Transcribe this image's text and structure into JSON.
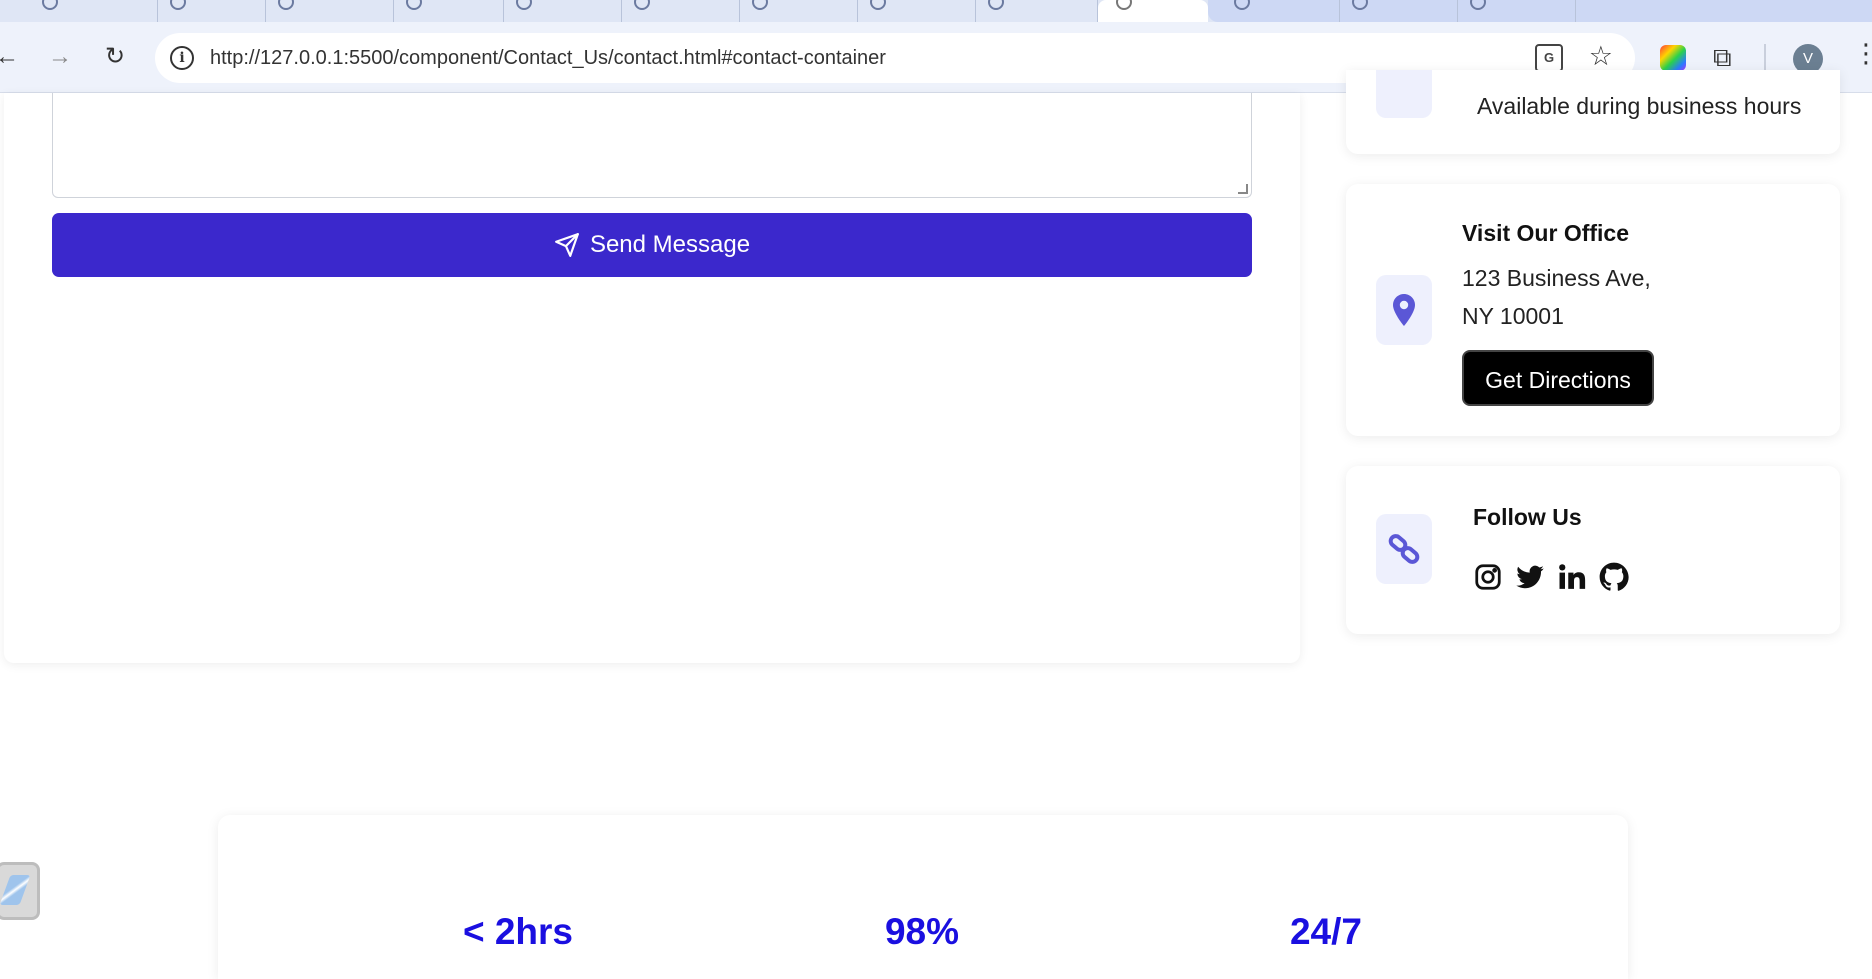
{
  "browser": {
    "url": "http://127.0.0.1:5500/component/Contact_Us/contact.html#contact-container",
    "profile_initial": "V"
  },
  "form": {
    "send_button_label": "Send Message"
  },
  "contact_cards": {
    "hours": {
      "text": "Available during business hours"
    },
    "office": {
      "title": "Visit Our Office",
      "address_line1": "123 Business Ave,",
      "address_line2": "NY 10001",
      "button_label": "Get Directions"
    },
    "social": {
      "title": "Follow Us",
      "icons": [
        "instagram-icon",
        "twitter-icon",
        "linkedin-icon",
        "github-icon"
      ]
    }
  },
  "stats": [
    {
      "value": "< 2hrs"
    },
    {
      "value": "98%"
    },
    {
      "value": "24/7"
    }
  ],
  "colors": {
    "accent": "#3b28cc",
    "stat_blue": "#1a0fe0",
    "icon_tile": "#eef0fd"
  }
}
